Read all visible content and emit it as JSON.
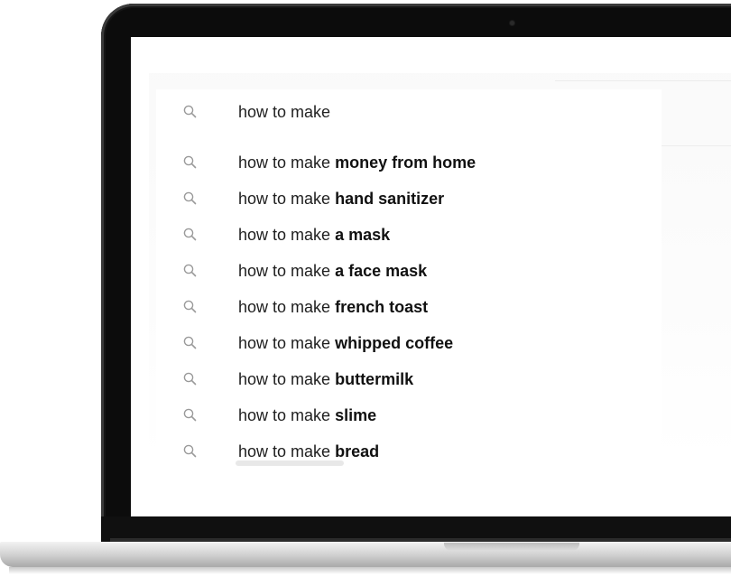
{
  "search": {
    "query": "how to make",
    "icon": "magnifier-icon",
    "suggestions": [
      {
        "prefix": "how to make",
        "completion": "money from home"
      },
      {
        "prefix": "how to make",
        "completion": "hand sanitizer"
      },
      {
        "prefix": "how to make",
        "completion": "a mask"
      },
      {
        "prefix": "how to make",
        "completion": "a face mask"
      },
      {
        "prefix": "how to make",
        "completion": "french toast"
      },
      {
        "prefix": "how to make",
        "completion": "whipped coffee"
      },
      {
        "prefix": "how to make",
        "completion": "buttermilk"
      },
      {
        "prefix": "how to make",
        "completion": "slime"
      },
      {
        "prefix": "how to make",
        "completion": "bread"
      }
    ]
  },
  "colors": {
    "bezel": "#0c0c0c",
    "text": "#1e1e1e",
    "icon": "#9a9a9a",
    "aluminum": "#d6d6d6"
  }
}
